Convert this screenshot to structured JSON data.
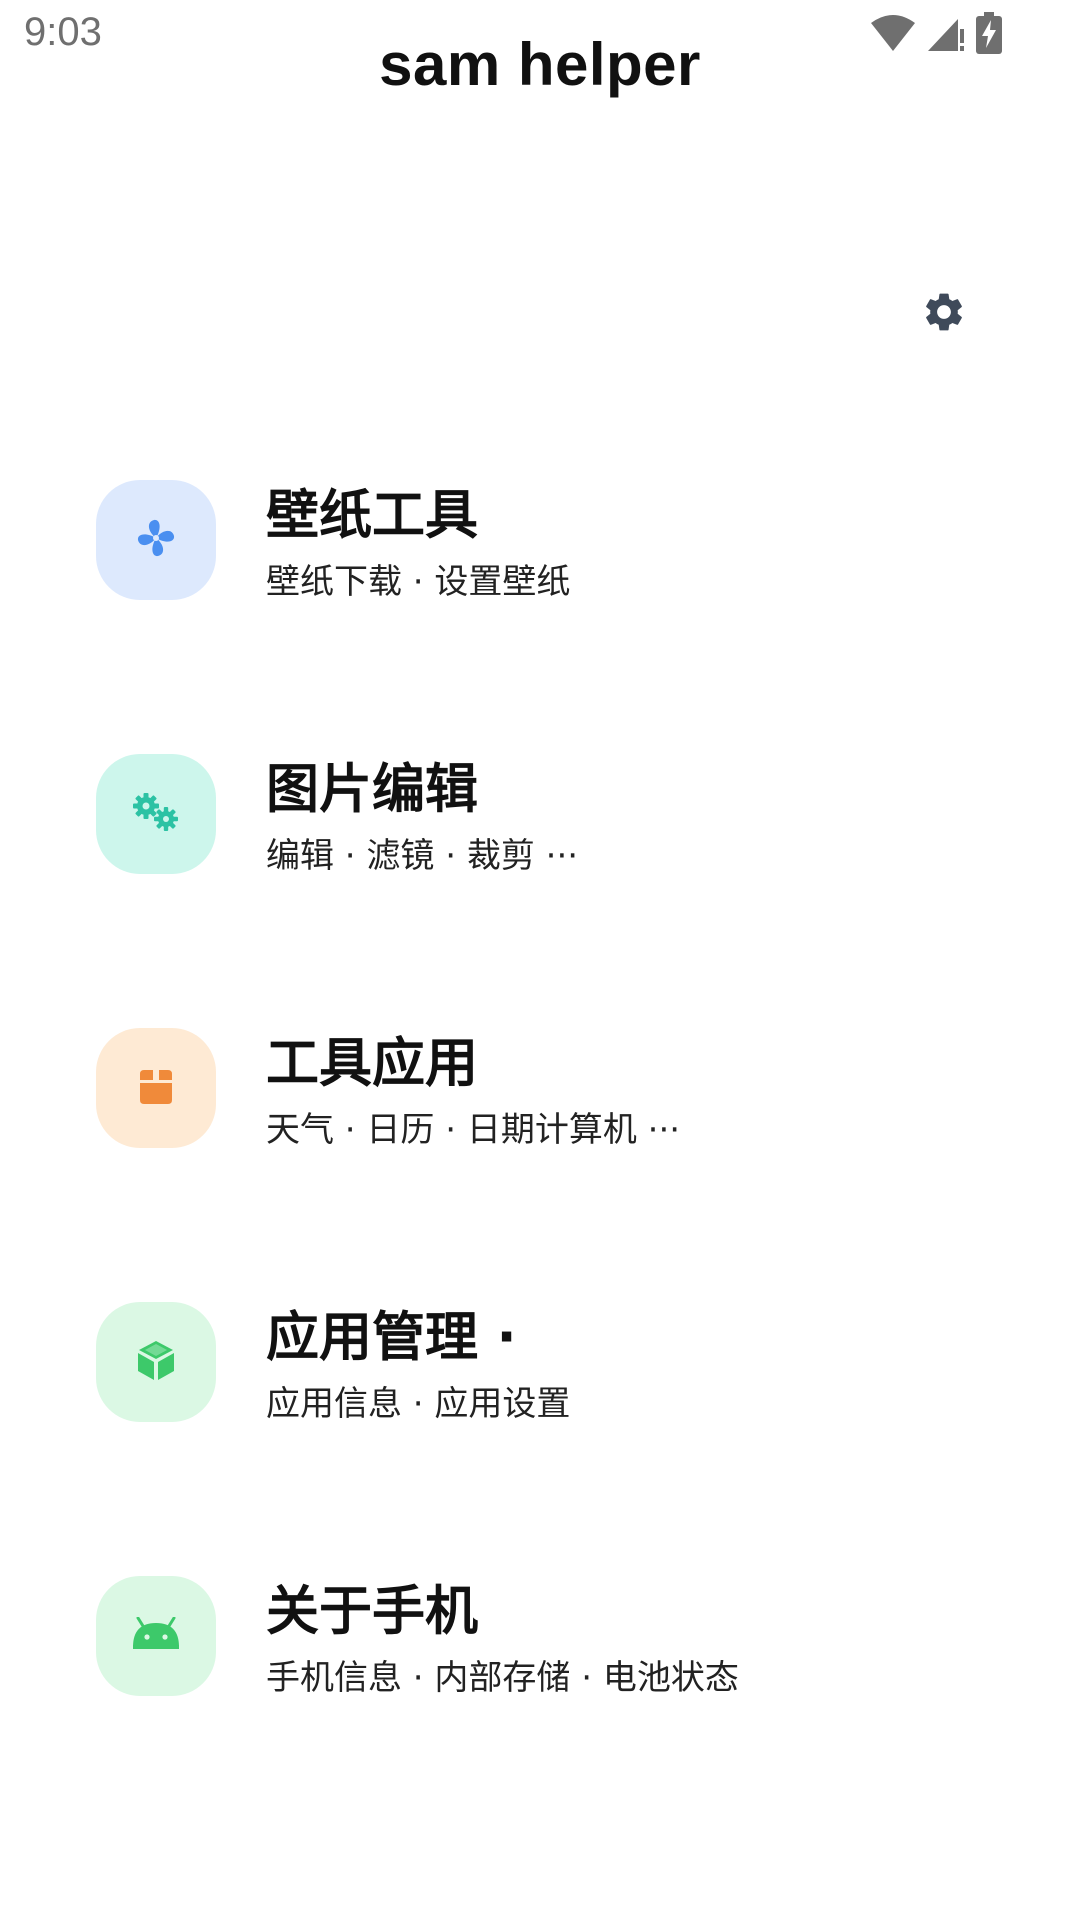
{
  "status_bar": {
    "time": "9:03",
    "icons": [
      "wifi-icon",
      "cell-signal-icon",
      "battery-charging-icon"
    ]
  },
  "header": {
    "title": "sam helper",
    "settings_icon": "gear-icon"
  },
  "menu": {
    "items": [
      {
        "title": "壁纸工具",
        "subtitle": "壁纸下载 · 设置壁纸",
        "icon": "pinwheel-icon",
        "icon_bg": "#dde9fd",
        "icon_color": "#4a8ff0"
      },
      {
        "title": "图片编辑",
        "subtitle": "编辑 · 滤镜 · 裁剪 ···",
        "icon": "gears-icon",
        "icon_bg": "#cdf6ec",
        "icon_color": "#2cc2a4"
      },
      {
        "title": "工具应用",
        "subtitle": "天气 · 日历 · 日期计算机 ···",
        "icon": "box-icon",
        "icon_bg": "#feead4",
        "icon_color": "#f08a3a"
      },
      {
        "title": "应用管理 ·",
        "subtitle": "应用信息 · 应用设置",
        "icon": "cube-icon",
        "icon_bg": "#dbf8e4",
        "icon_color": "#3dc96a"
      },
      {
        "title": "关于手机",
        "subtitle": "手机信息 · 内部存储 · 电池状态",
        "icon": "android-icon",
        "icon_bg": "#dbf8e4",
        "icon_color": "#3dc96a"
      }
    ]
  }
}
